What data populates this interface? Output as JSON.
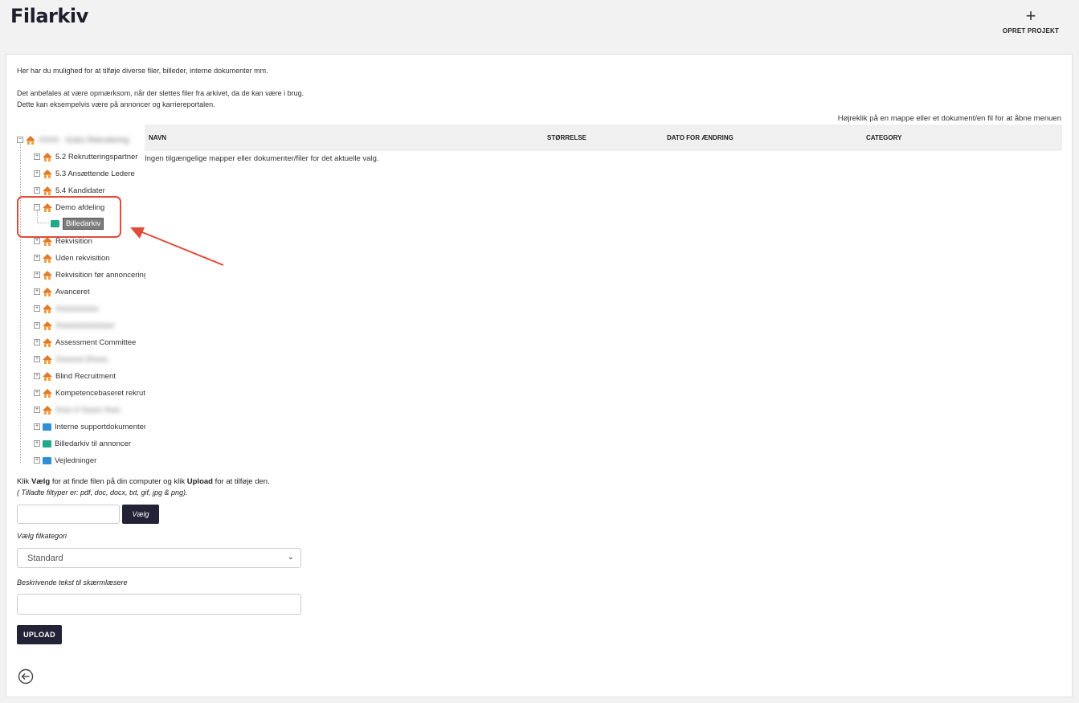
{
  "header": {
    "title": "Filarkiv",
    "create_project_label": "OPRET PROJEKT"
  },
  "intro": {
    "line1": "Her har du mulighed for at tilføje diverse filer, billeder, interne dokumenter mm.",
    "line2": "Det anbefales at være opmærksom, når der slettes filer fra arkivet, da de kan være i brug.",
    "line3": "Dette kan eksempelvis være på annoncer og karriereportalen."
  },
  "hint": "Højreklik på en mappe eller et dokument/en fil for at åbne menuen",
  "tree": {
    "root_label": "XXXX - Sutes Rekruttering",
    "items": [
      {
        "label": "5.2 Rekrutteringspartner",
        "icon": "home-icon",
        "blurred": false
      },
      {
        "label": "5.3 Ansættende Ledere",
        "icon": "home-icon",
        "blurred": false
      },
      {
        "label": "5.4 Kandidater",
        "icon": "home-icon",
        "blurred": false
      },
      {
        "label": "Demo afdeling",
        "icon": "home-icon",
        "blurred": false
      },
      {
        "label": "Billedarkiv",
        "icon": "folder-icon",
        "blurred": false,
        "selected": true
      },
      {
        "label": "Rekvisition",
        "icon": "home-icon",
        "blurred": false
      },
      {
        "label": "Uden rekvisition",
        "icon": "home-icon",
        "blurred": false
      },
      {
        "label": "Rekvisition før annoncering",
        "icon": "home-icon",
        "blurred": false
      },
      {
        "label": "Avanceret",
        "icon": "home-icon",
        "blurred": false
      },
      {
        "label": "Xxxxxxxxxxx",
        "icon": "home-icon",
        "blurred": true
      },
      {
        "label": "Xxxxxxxxxxxxxxx",
        "icon": "home-icon",
        "blurred": true
      },
      {
        "label": "Assessment Committee",
        "icon": "home-icon",
        "blurred": false
      },
      {
        "label": "Xxxxxxx (Xxxx)",
        "icon": "home-icon",
        "blurred": true
      },
      {
        "label": "Blind Recruitment",
        "icon": "home-icon",
        "blurred": false
      },
      {
        "label": "Kompetencebaseret rekruttering",
        "icon": "home-icon",
        "blurred": false
      },
      {
        "label": "Xxxx X Xxxxx Xxxx",
        "icon": "home-icon",
        "blurred": true
      },
      {
        "label": "Interne supportdokumenter",
        "icon": "folder-icon",
        "blurred": false
      },
      {
        "label": "Billedarkiv til annoncer",
        "icon": "folder-icon",
        "blurred": false
      },
      {
        "label": "Vejledninger",
        "icon": "folder-icon",
        "blurred": false
      }
    ]
  },
  "table": {
    "columns": [
      "NAVN",
      "STØRRELSE",
      "DATO FOR ÆNDRING",
      "CATEGORY"
    ],
    "empty_message": "Ingen tilgængelige mapper eller dokumenter/filer for det aktuelle valg."
  },
  "upload": {
    "instruction_pre": "Klik ",
    "instruction_choose": "Vælg",
    "instruction_mid": " for at finde filen på din computer og klik ",
    "instruction_upload": "Upload",
    "instruction_post": " for at tilføje den.",
    "allowed_types": "( Tilladte filtyper er: pdf, doc, docx, txt, gif, jpg & png).",
    "choose_button": "Vælg",
    "category_label": "Vælg filkategori",
    "category_selected": "Standard",
    "alt_text_label": "Beskrivende tekst til skærmlæsere",
    "upload_button": "UPLOAD"
  },
  "colors": {
    "primary_button": "#232338",
    "highlight": "#e04b3a",
    "folder_icon": "#e07a2e"
  }
}
